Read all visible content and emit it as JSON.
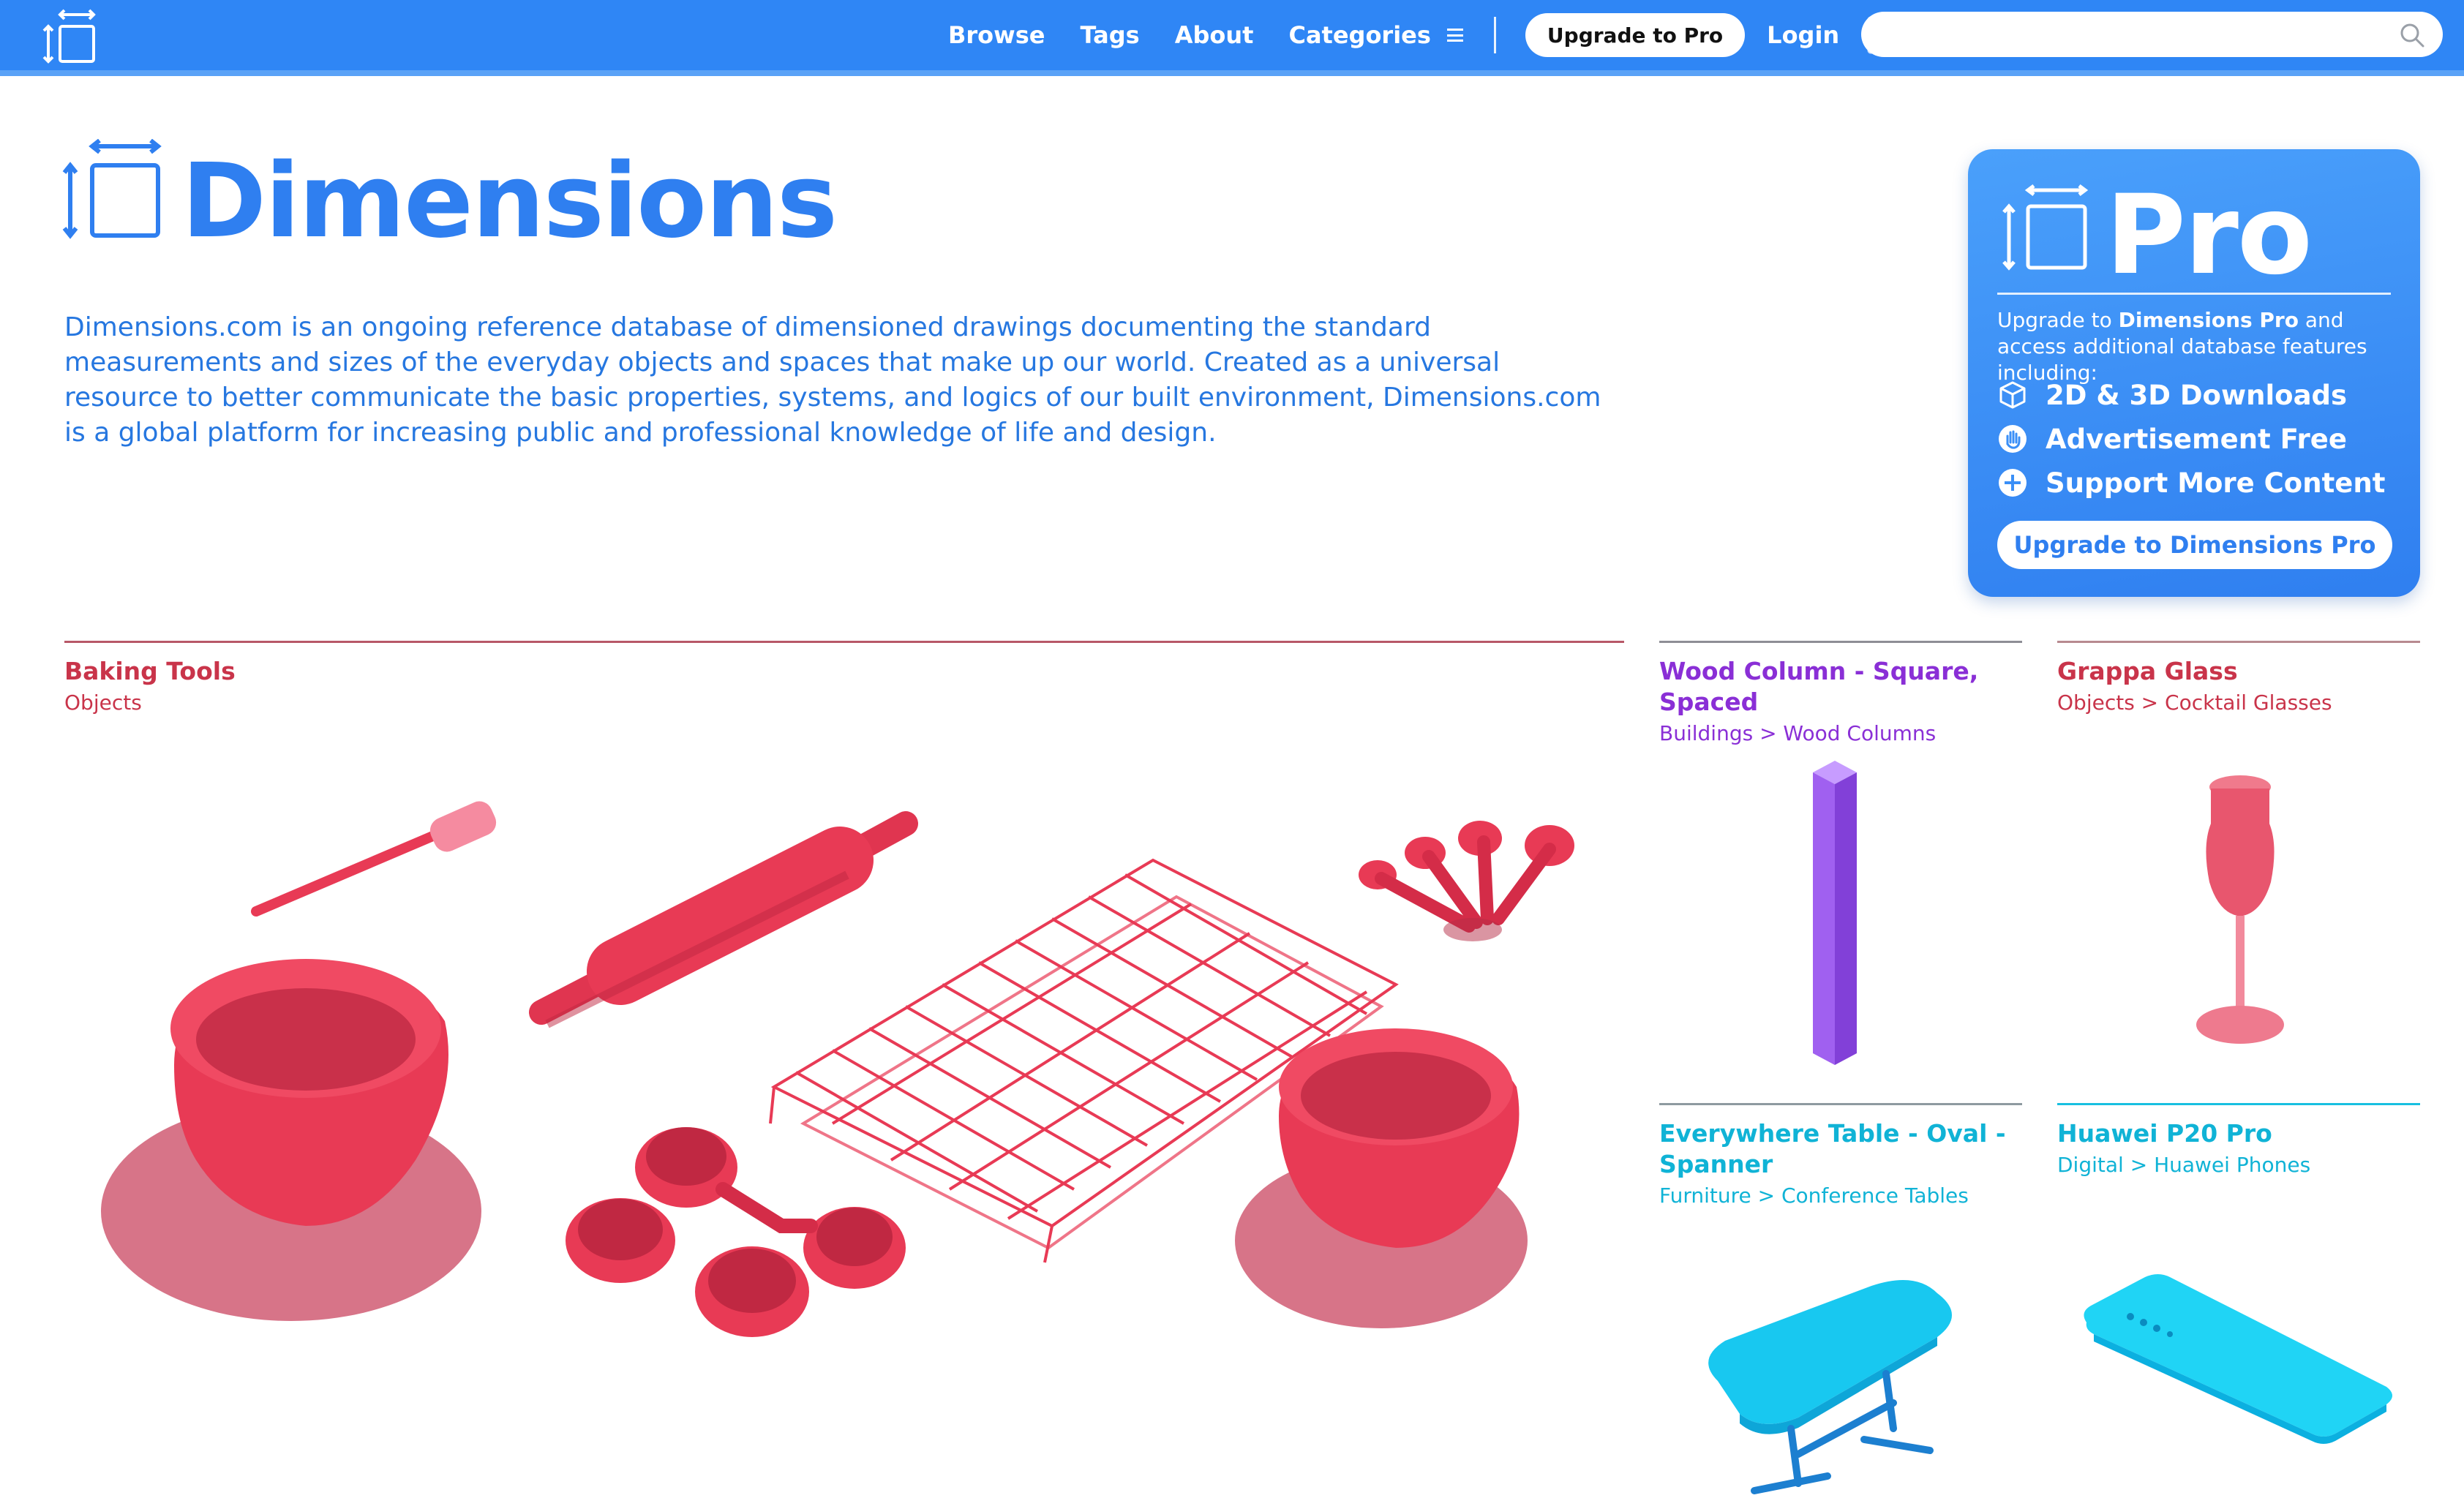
{
  "nav": {
    "links": [
      "Browse",
      "Tags",
      "About"
    ],
    "categories_label": "Categories",
    "upgrade_label": "Upgrade to Pro",
    "login_label": "Login",
    "search_placeholder": ""
  },
  "hero": {
    "title": "Dimensions",
    "description": "Dimensions.com is an ongoing reference database of dimensioned drawings documenting the standard measurements and sizes of the everyday objects and spaces that make up our world. Created as a universal resource to better communicate the basic properties, systems, and logics of our built environment, Dimensions.com is a global platform for increasing public and professional knowledge of life and design."
  },
  "pro": {
    "title": "Pro",
    "text_prefix": "Upgrade to ",
    "text_bold": "Dimensions Pro",
    "text_suffix": " and access additional database features including:",
    "features": [
      {
        "label": "2D & 3D Downloads",
        "icon": "cube-icon"
      },
      {
        "label": "Advertisement Free",
        "icon": "hand-icon"
      },
      {
        "label": "Support More Content",
        "icon": "plus-circle-icon"
      }
    ],
    "button_label": "Upgrade to Dimensions Pro"
  },
  "cards": [
    {
      "title": "Baking Tools",
      "category": "Objects",
      "color": "#c9344a"
    },
    {
      "title": "Wood Column - Square, Spaced",
      "category": "Buildings > Wood Columns",
      "color": "#8a2fd6"
    },
    {
      "title": "Grappa Glass",
      "category": "Objects > Cocktail Glasses",
      "color": "#c9344a"
    },
    {
      "title": "Everywhere Table - Oval - Spanner",
      "category": "Furniture > Conference Tables",
      "color": "#10b3d6"
    },
    {
      "title": "Huawei P20 Pro",
      "category": "Digital > Huawei Phones",
      "color": "#10b3d6"
    }
  ],
  "colors": {
    "nav_bg": "#2f86f5",
    "brand_blue": "#2f7ff0",
    "object_red": "#e83a55",
    "object_purple": "#a060f0",
    "object_cyan": "#18c8f0"
  }
}
